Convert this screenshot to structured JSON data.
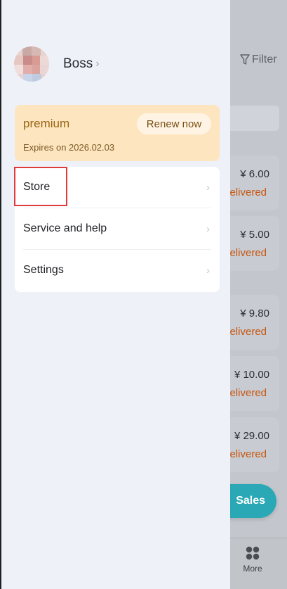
{
  "background": {
    "filter_label": "Filter",
    "orders": [
      {
        "price": "¥ 6.00",
        "status": "elivered"
      },
      {
        "price": "¥ 5.00",
        "status": "elivered"
      },
      {
        "price": "¥ 9.80",
        "status": "elivered"
      },
      {
        "price": "¥ 10.00",
        "status": "elivered"
      },
      {
        "price": "¥ 29.00",
        "status": "elivered"
      }
    ],
    "sales_label": "Sales",
    "more_label": "More"
  },
  "drawer": {
    "user_name": "Boss",
    "premium": {
      "title": "premium",
      "renew_label": "Renew now",
      "expiry": "Expires on 2026.02.03"
    },
    "menu": [
      {
        "label": "Store"
      },
      {
        "label": "Service and help"
      },
      {
        "label": "Settings"
      }
    ]
  },
  "colors": {
    "drawer_bg": "#eef2f8",
    "premium_bg": "#fce5bf",
    "status_orange": "#c7540e",
    "sales_teal": "#2aa8b5",
    "highlight_red": "#e03a3a"
  }
}
